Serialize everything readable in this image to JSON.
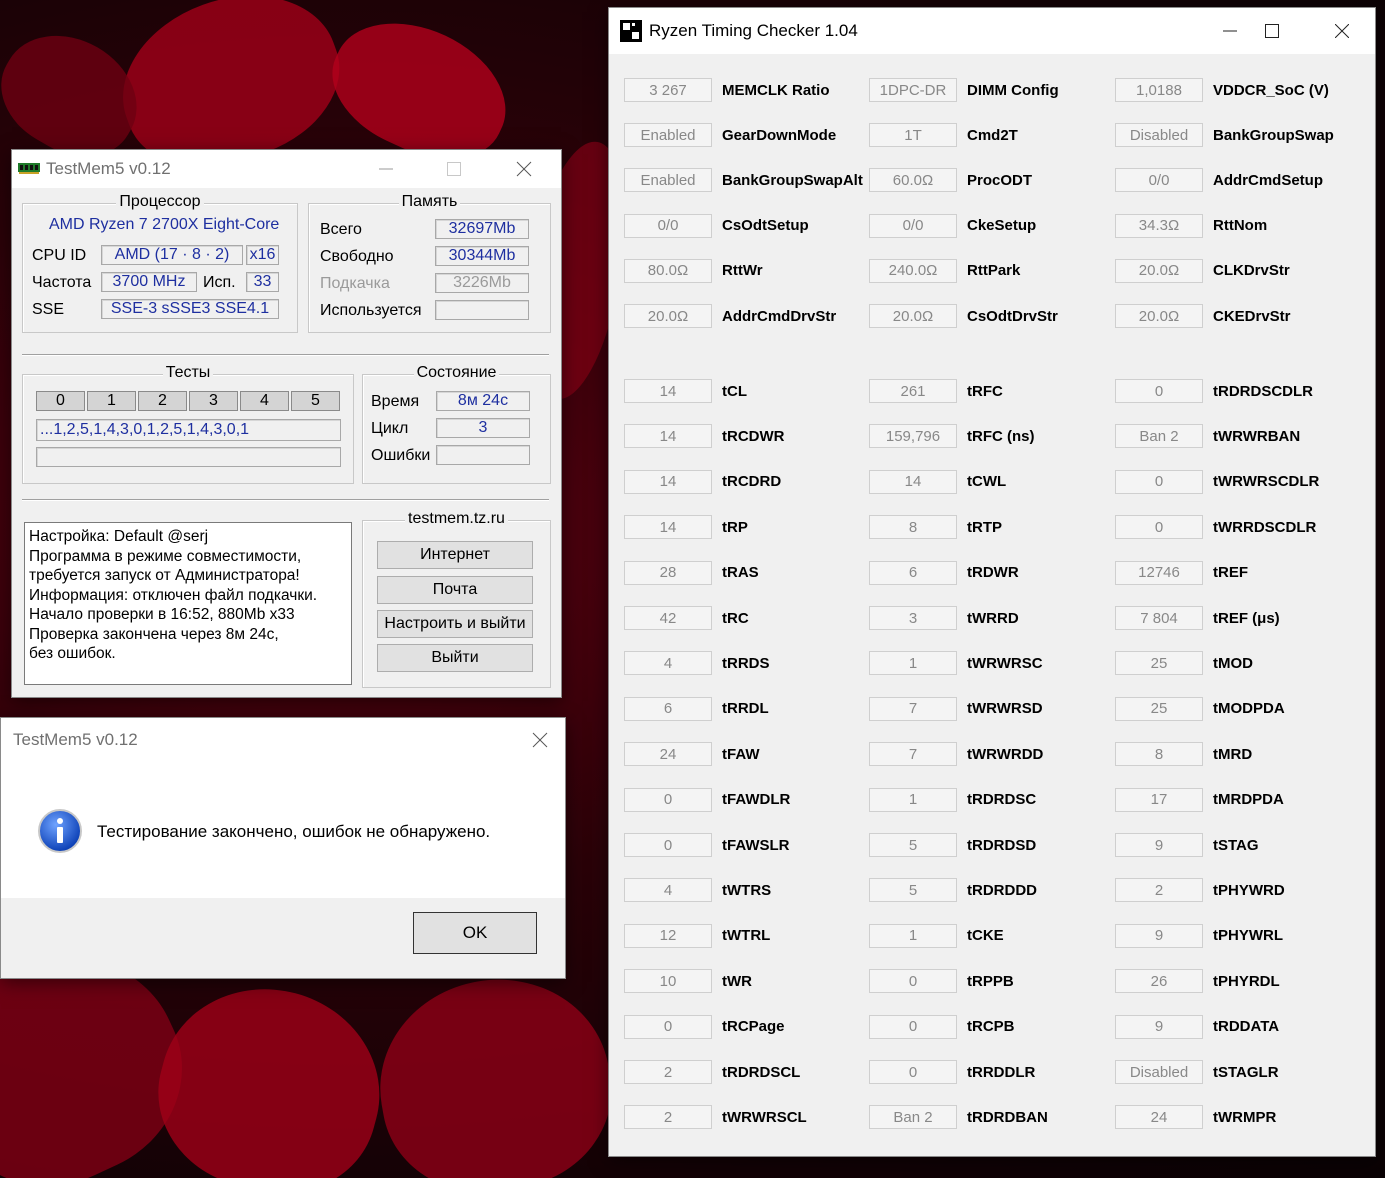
{
  "rtc": {
    "title": "Ryzen Timing Checker 1.04",
    "rows": [
      [
        [
          "3 267",
          "MEMCLK Ratio"
        ],
        [
          "1DPC-DR",
          "DIMM Config"
        ],
        [
          "1,0188",
          "VDDCR_SoC (V)"
        ]
      ],
      [
        [
          "Enabled",
          "GearDownMode"
        ],
        [
          "1T",
          "Cmd2T"
        ],
        [
          "Disabled",
          "BankGroupSwap"
        ]
      ],
      [
        [
          "Enabled",
          "BankGroupSwapAlt"
        ],
        [
          "60.0Ω",
          "ProcODT"
        ],
        [
          "0/0",
          "AddrCmdSetup"
        ]
      ],
      [
        [
          "0/0",
          "CsOdtSetup"
        ],
        [
          "0/0",
          "CkeSetup"
        ],
        [
          "34.3Ω",
          "RttNom"
        ]
      ],
      [
        [
          "80.0Ω",
          "RttWr"
        ],
        [
          "240.0Ω",
          "RttPark"
        ],
        [
          "20.0Ω",
          "CLKDrvStr"
        ]
      ],
      [
        [
          "20.0Ω",
          "AddrCmdDrvStr"
        ],
        [
          "20.0Ω",
          "CsOdtDrvStr"
        ],
        [
          "20.0Ω",
          "CKEDrvStr"
        ]
      ],
      [
        [
          "14",
          "tCL"
        ],
        [
          "261",
          "tRFC"
        ],
        [
          "0",
          "tRDRDSCDLR"
        ]
      ],
      [
        [
          "14",
          "tRCDWR"
        ],
        [
          "159,796",
          "tRFC (ns)"
        ],
        [
          "Ban 2",
          "tWRWRBAN"
        ]
      ],
      [
        [
          "14",
          "tRCDRD"
        ],
        [
          "14",
          "tCWL"
        ],
        [
          "0",
          "tWRWRSCDLR"
        ]
      ],
      [
        [
          "14",
          "tRP"
        ],
        [
          "8",
          "tRTP"
        ],
        [
          "0",
          "tWRRDSCDLR"
        ]
      ],
      [
        [
          "28",
          "tRAS"
        ],
        [
          "6",
          "tRDWR"
        ],
        [
          "12746",
          "tREF"
        ]
      ],
      [
        [
          "42",
          "tRC"
        ],
        [
          "3",
          "tWRRD"
        ],
        [
          "7 804",
          "tREF (μs)"
        ]
      ],
      [
        [
          "4",
          "tRRDS"
        ],
        [
          "1",
          "tWRWRSC"
        ],
        [
          "25",
          "tMOD"
        ]
      ],
      [
        [
          "6",
          "tRRDL"
        ],
        [
          "7",
          "tWRWRSD"
        ],
        [
          "25",
          "tMODPDA"
        ]
      ],
      [
        [
          "24",
          "tFAW"
        ],
        [
          "7",
          "tWRWRDD"
        ],
        [
          "8",
          "tMRD"
        ]
      ],
      [
        [
          "0",
          "tFAWDLR"
        ],
        [
          "1",
          "tRDRDSC"
        ],
        [
          "17",
          "tMRDPDA"
        ]
      ],
      [
        [
          "0",
          "tFAWSLR"
        ],
        [
          "5",
          "tRDRDSD"
        ],
        [
          "9",
          "tSTAG"
        ]
      ],
      [
        [
          "4",
          "tWTRS"
        ],
        [
          "5",
          "tRDRDDD"
        ],
        [
          "2",
          "tPHYWRD"
        ]
      ],
      [
        [
          "12",
          "tWTRL"
        ],
        [
          "1",
          "tCKE"
        ],
        [
          "9",
          "tPHYWRL"
        ]
      ],
      [
        [
          "10",
          "tWR"
        ],
        [
          "0",
          "tRPPB"
        ],
        [
          "26",
          "tPHYRDL"
        ]
      ],
      [
        [
          "0",
          "tRCPage"
        ],
        [
          "0",
          "tRCPB"
        ],
        [
          "9",
          "tRDDATA"
        ]
      ],
      [
        [
          "2",
          "tRDRDSCL"
        ],
        [
          "0",
          "tRRDDLR"
        ],
        [
          "Disabled",
          "tSTAGLR"
        ]
      ],
      [
        [
          "2",
          "tWRWRSCL"
        ],
        [
          "Ban 2",
          "tRDRDBAN"
        ],
        [
          "24",
          "tWRMPR"
        ]
      ]
    ]
  },
  "tm5": {
    "title": "TestMem5 v0.12",
    "cpu": {
      "group": "Процессор",
      "name": "AMD Ryzen 7 2700X Eight-Core",
      "cpuid_label": "CPU ID",
      "cpuid_value": "AMD  (17 · 8 · 2)",
      "threads": "x16",
      "freq_label": "Частота",
      "freq_value": "3700 MHz",
      "used_label": "Исп.",
      "used_value": "33",
      "sse_label": "SSE",
      "sse_value": "SSE-3 sSSE3 SSE4.1"
    },
    "memory": {
      "group": "Память",
      "total_label": "Всего",
      "total_value": "32697Mb",
      "free_label": "Свободно",
      "free_value": "30344Mb",
      "swap_label": "Подкачка",
      "swap_value": "3226Mb",
      "inuse_label": "Используется",
      "inuse_value": ""
    },
    "tests": {
      "group": "Тесты",
      "cells": [
        "0",
        "1",
        "2",
        "3",
        "4",
        "5"
      ],
      "sequence": "...1,2,5,1,4,3,0,1,2,5,1,4,3,0,1"
    },
    "state": {
      "group": "Состояние",
      "time_label": "Время",
      "time_value": "8м 24с",
      "cycle_label": "Цикл",
      "cycle_value": "3",
      "errors_label": "Ошибки",
      "errors_value": ""
    },
    "log": [
      "Настройка: Default @serj",
      "Программа в режиме совместимости,",
      "требуется запуск от Администратора!",
      "Информация: отключен файл подкачки.",
      "Начало проверки в 16:52, 880Mb x33",
      "Проверка закончена через 8м 24с,",
      "без ошибок."
    ],
    "site": "testmem.tz.ru",
    "buttons": {
      "internet": "Интернет",
      "mail": "Почта",
      "configure": "Настроить и выйти",
      "exit": "Выйти"
    }
  },
  "dialog": {
    "title": "TestMem5 v0.12",
    "message": "Тестирование закончено, ошибок не обнаружено.",
    "ok": "OK"
  }
}
